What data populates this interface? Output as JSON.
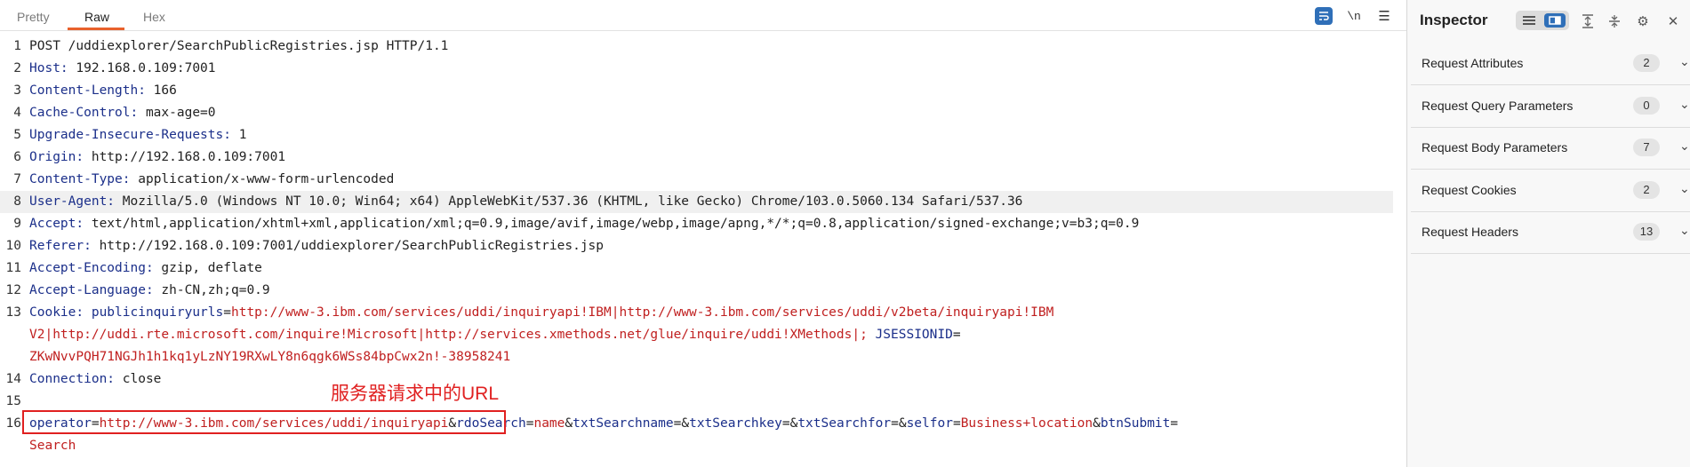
{
  "tabs": [
    {
      "label": "Pretty"
    },
    {
      "label": "Raw"
    },
    {
      "label": "Hex"
    }
  ],
  "toolbar": {
    "newline_label": "\\n"
  },
  "lines": [
    {
      "n": "1",
      "parts": [
        {
          "t": "POST /uddiexplorer/SearchPublicRegistries.jsp HTTP/1.1",
          "c": "hv"
        }
      ]
    },
    {
      "n": "2",
      "parts": [
        {
          "t": "Host:",
          "c": "hn"
        },
        {
          "t": " 192.168.0.109:7001",
          "c": "hv"
        }
      ]
    },
    {
      "n": "3",
      "parts": [
        {
          "t": "Content-Length:",
          "c": "hn"
        },
        {
          "t": " 166",
          "c": "hv"
        }
      ]
    },
    {
      "n": "4",
      "parts": [
        {
          "t": "Cache-Control:",
          "c": "hn"
        },
        {
          "t": " max-age=0",
          "c": "hv"
        }
      ]
    },
    {
      "n": "5",
      "parts": [
        {
          "t": "Upgrade-Insecure-Requests:",
          "c": "hn"
        },
        {
          "t": " 1",
          "c": "hv"
        }
      ]
    },
    {
      "n": "6",
      "parts": [
        {
          "t": "Origin:",
          "c": "hn"
        },
        {
          "t": " http://192.168.0.109:7001",
          "c": "hv"
        }
      ]
    },
    {
      "n": "7",
      "parts": [
        {
          "t": "Content-Type:",
          "c": "hn"
        },
        {
          "t": " application/x-www-form-urlencoded",
          "c": "hv"
        }
      ]
    },
    {
      "n": "8",
      "highlight": true,
      "parts": [
        {
          "t": "User-Agent:",
          "c": "hn"
        },
        {
          "t": " Mozilla/5.0 (Windows NT 10.0; Win64; x64) AppleWebKit/537.36 (KHTML, like Gecko) Chrome/103.0.5060.134 Safari/537.36",
          "c": "hv"
        }
      ]
    },
    {
      "n": "9",
      "parts": [
        {
          "t": "Accept:",
          "c": "hn"
        },
        {
          "t": " text/html,application/xhtml+xml,application/xml;q=0.9,image/avif,image/webp,image/apng,*/*;q=0.8,application/signed-exchange;v=b3;q=0.9",
          "c": "hv"
        }
      ]
    },
    {
      "n": "10",
      "parts": [
        {
          "t": "Referer:",
          "c": "hn"
        },
        {
          "t": " http://192.168.0.109:7001/uddiexplorer/SearchPublicRegistries.jsp",
          "c": "hv"
        }
      ]
    },
    {
      "n": "11",
      "parts": [
        {
          "t": "Accept-Encoding:",
          "c": "hn"
        },
        {
          "t": " gzip, deflate",
          "c": "hv"
        }
      ]
    },
    {
      "n": "12",
      "parts": [
        {
          "t": "Accept-Language:",
          "c": "hn"
        },
        {
          "t": " zh-CN,zh;q=0.9",
          "c": "hv"
        }
      ]
    },
    {
      "n": "13",
      "parts": [
        {
          "t": "Cookie:",
          "c": "hn"
        },
        {
          "t": " ",
          "c": "hv"
        },
        {
          "t": "publicinquiryurls",
          "c": "ck"
        },
        {
          "t": "=",
          "c": "hv"
        },
        {
          "t": "http://www-3.ibm.com/services/uddi/inquiryapi!IBM|http://www-3.ibm.com/services/uddi/v2beta/inquiryapi!IBM",
          "c": "cv"
        }
      ]
    },
    {
      "n": "",
      "parts": [
        {
          "t": "V2|http://uddi.rte.microsoft.com/inquire!Microsoft|http://services.xmethods.net/glue/inquire/uddi!XMethods|;",
          "c": "cv"
        },
        {
          "t": " ",
          "c": "hv"
        },
        {
          "t": "JSESSIONID",
          "c": "ck"
        },
        {
          "t": "=",
          "c": "hv"
        }
      ]
    },
    {
      "n": "",
      "parts": [
        {
          "t": "ZKwNvvPQH71NGJh1h1kq1yLzNY19RXwLY8n6qgk6WSs84bpCwx2n!-38958241",
          "c": "cv"
        }
      ]
    },
    {
      "n": "14",
      "parts": [
        {
          "t": "Connection:",
          "c": "hn"
        },
        {
          "t": " close",
          "c": "hv"
        }
      ]
    },
    {
      "n": "15",
      "parts": []
    },
    {
      "n": "16",
      "parts": [
        {
          "t": "operator",
          "c": "ck"
        },
        {
          "t": "=",
          "c": "hv"
        },
        {
          "t": "http://www-3.ibm.com/services/uddi/inquiryapi",
          "c": "cv"
        },
        {
          "t": "&",
          "c": "hv"
        },
        {
          "t": "rdoSearch",
          "c": "ck"
        },
        {
          "t": "=",
          "c": "hv"
        },
        {
          "t": "name",
          "c": "cv"
        },
        {
          "t": "&",
          "c": "hv"
        },
        {
          "t": "txtSearchname",
          "c": "ck"
        },
        {
          "t": "=&",
          "c": "hv"
        },
        {
          "t": "txtSearchkey",
          "c": "ck"
        },
        {
          "t": "=&",
          "c": "hv"
        },
        {
          "t": "txtSearchfor",
          "c": "ck"
        },
        {
          "t": "=&",
          "c": "hv"
        },
        {
          "t": "selfor",
          "c": "ck"
        },
        {
          "t": "=",
          "c": "hv"
        },
        {
          "t": "Business+location",
          "c": "cv"
        },
        {
          "t": "&",
          "c": "hv"
        },
        {
          "t": "btnSubmit",
          "c": "ck"
        },
        {
          "t": "=",
          "c": "hv"
        }
      ]
    },
    {
      "n": "",
      "parts": [
        {
          "t": "Search",
          "c": "cv"
        }
      ]
    }
  ],
  "annotation": {
    "text": "服务器请求中的URL",
    "color": "#e02020"
  },
  "inspector": {
    "title": "Inspector",
    "sections": [
      {
        "label": "Request Attributes",
        "count": "2"
      },
      {
        "label": "Request Query Parameters",
        "count": "0"
      },
      {
        "label": "Request Body Parameters",
        "count": "7"
      },
      {
        "label": "Request Cookies",
        "count": "2"
      },
      {
        "label": "Request Headers",
        "count": "13"
      }
    ]
  },
  "colors": {
    "accent": "#e8612c",
    "toggle_active": "#2f6fb8",
    "header_name": "#1b2f8a",
    "value_red": "#c02020"
  }
}
